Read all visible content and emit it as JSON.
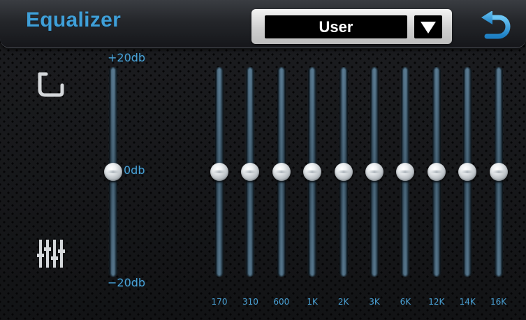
{
  "header": {
    "title": "Equalizer",
    "preset": "User"
  },
  "scale": {
    "max": "+20db",
    "mid": "0db",
    "min": "−20db"
  },
  "master": {
    "level": 0
  },
  "bands": [
    {
      "freq": "170",
      "level": 0
    },
    {
      "freq": "310",
      "level": 0
    },
    {
      "freq": "600",
      "level": 0
    },
    {
      "freq": "1K",
      "level": 0
    },
    {
      "freq": "2K",
      "level": 0
    },
    {
      "freq": "3K",
      "level": 0
    },
    {
      "freq": "6K",
      "level": 0
    },
    {
      "freq": "12K",
      "level": 0
    },
    {
      "freq": "14K",
      "level": 0
    },
    {
      "freq": "16K",
      "level": 0
    }
  ],
  "icons": {
    "back": "back-arrow-icon",
    "reset": "reset-icon",
    "eq": "equalizer-icon",
    "dropdown": "dropdown-triangle-icon"
  },
  "colors": {
    "accent": "#3f9fd8",
    "label": "#4aa2d6",
    "background": "#141517"
  }
}
